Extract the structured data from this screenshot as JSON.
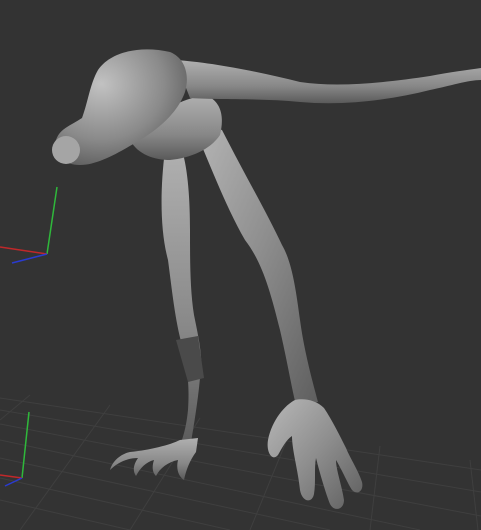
{
  "viewport": {
    "background": "#333333",
    "model_color": "#8c8c8c",
    "grid_color": "#3f3f3f"
  },
  "gizmos": [
    {
      "name": "axis-gizmo-upper",
      "axes": [
        "x",
        "y",
        "z"
      ],
      "colors": {
        "x": "#c0282a",
        "y": "#2fb83b",
        "z": "#2a3bd0"
      }
    },
    {
      "name": "axis-gizmo-lower",
      "axes": [
        "x",
        "y",
        "z"
      ],
      "colors": {
        "x": "#c0282a",
        "y": "#2fb83b",
        "z": "#2a3bd0"
      }
    }
  ],
  "icons": [
    "sculpted-creature-model-icon",
    "floor-grid-icon",
    "axis-gizmo-icon"
  ]
}
